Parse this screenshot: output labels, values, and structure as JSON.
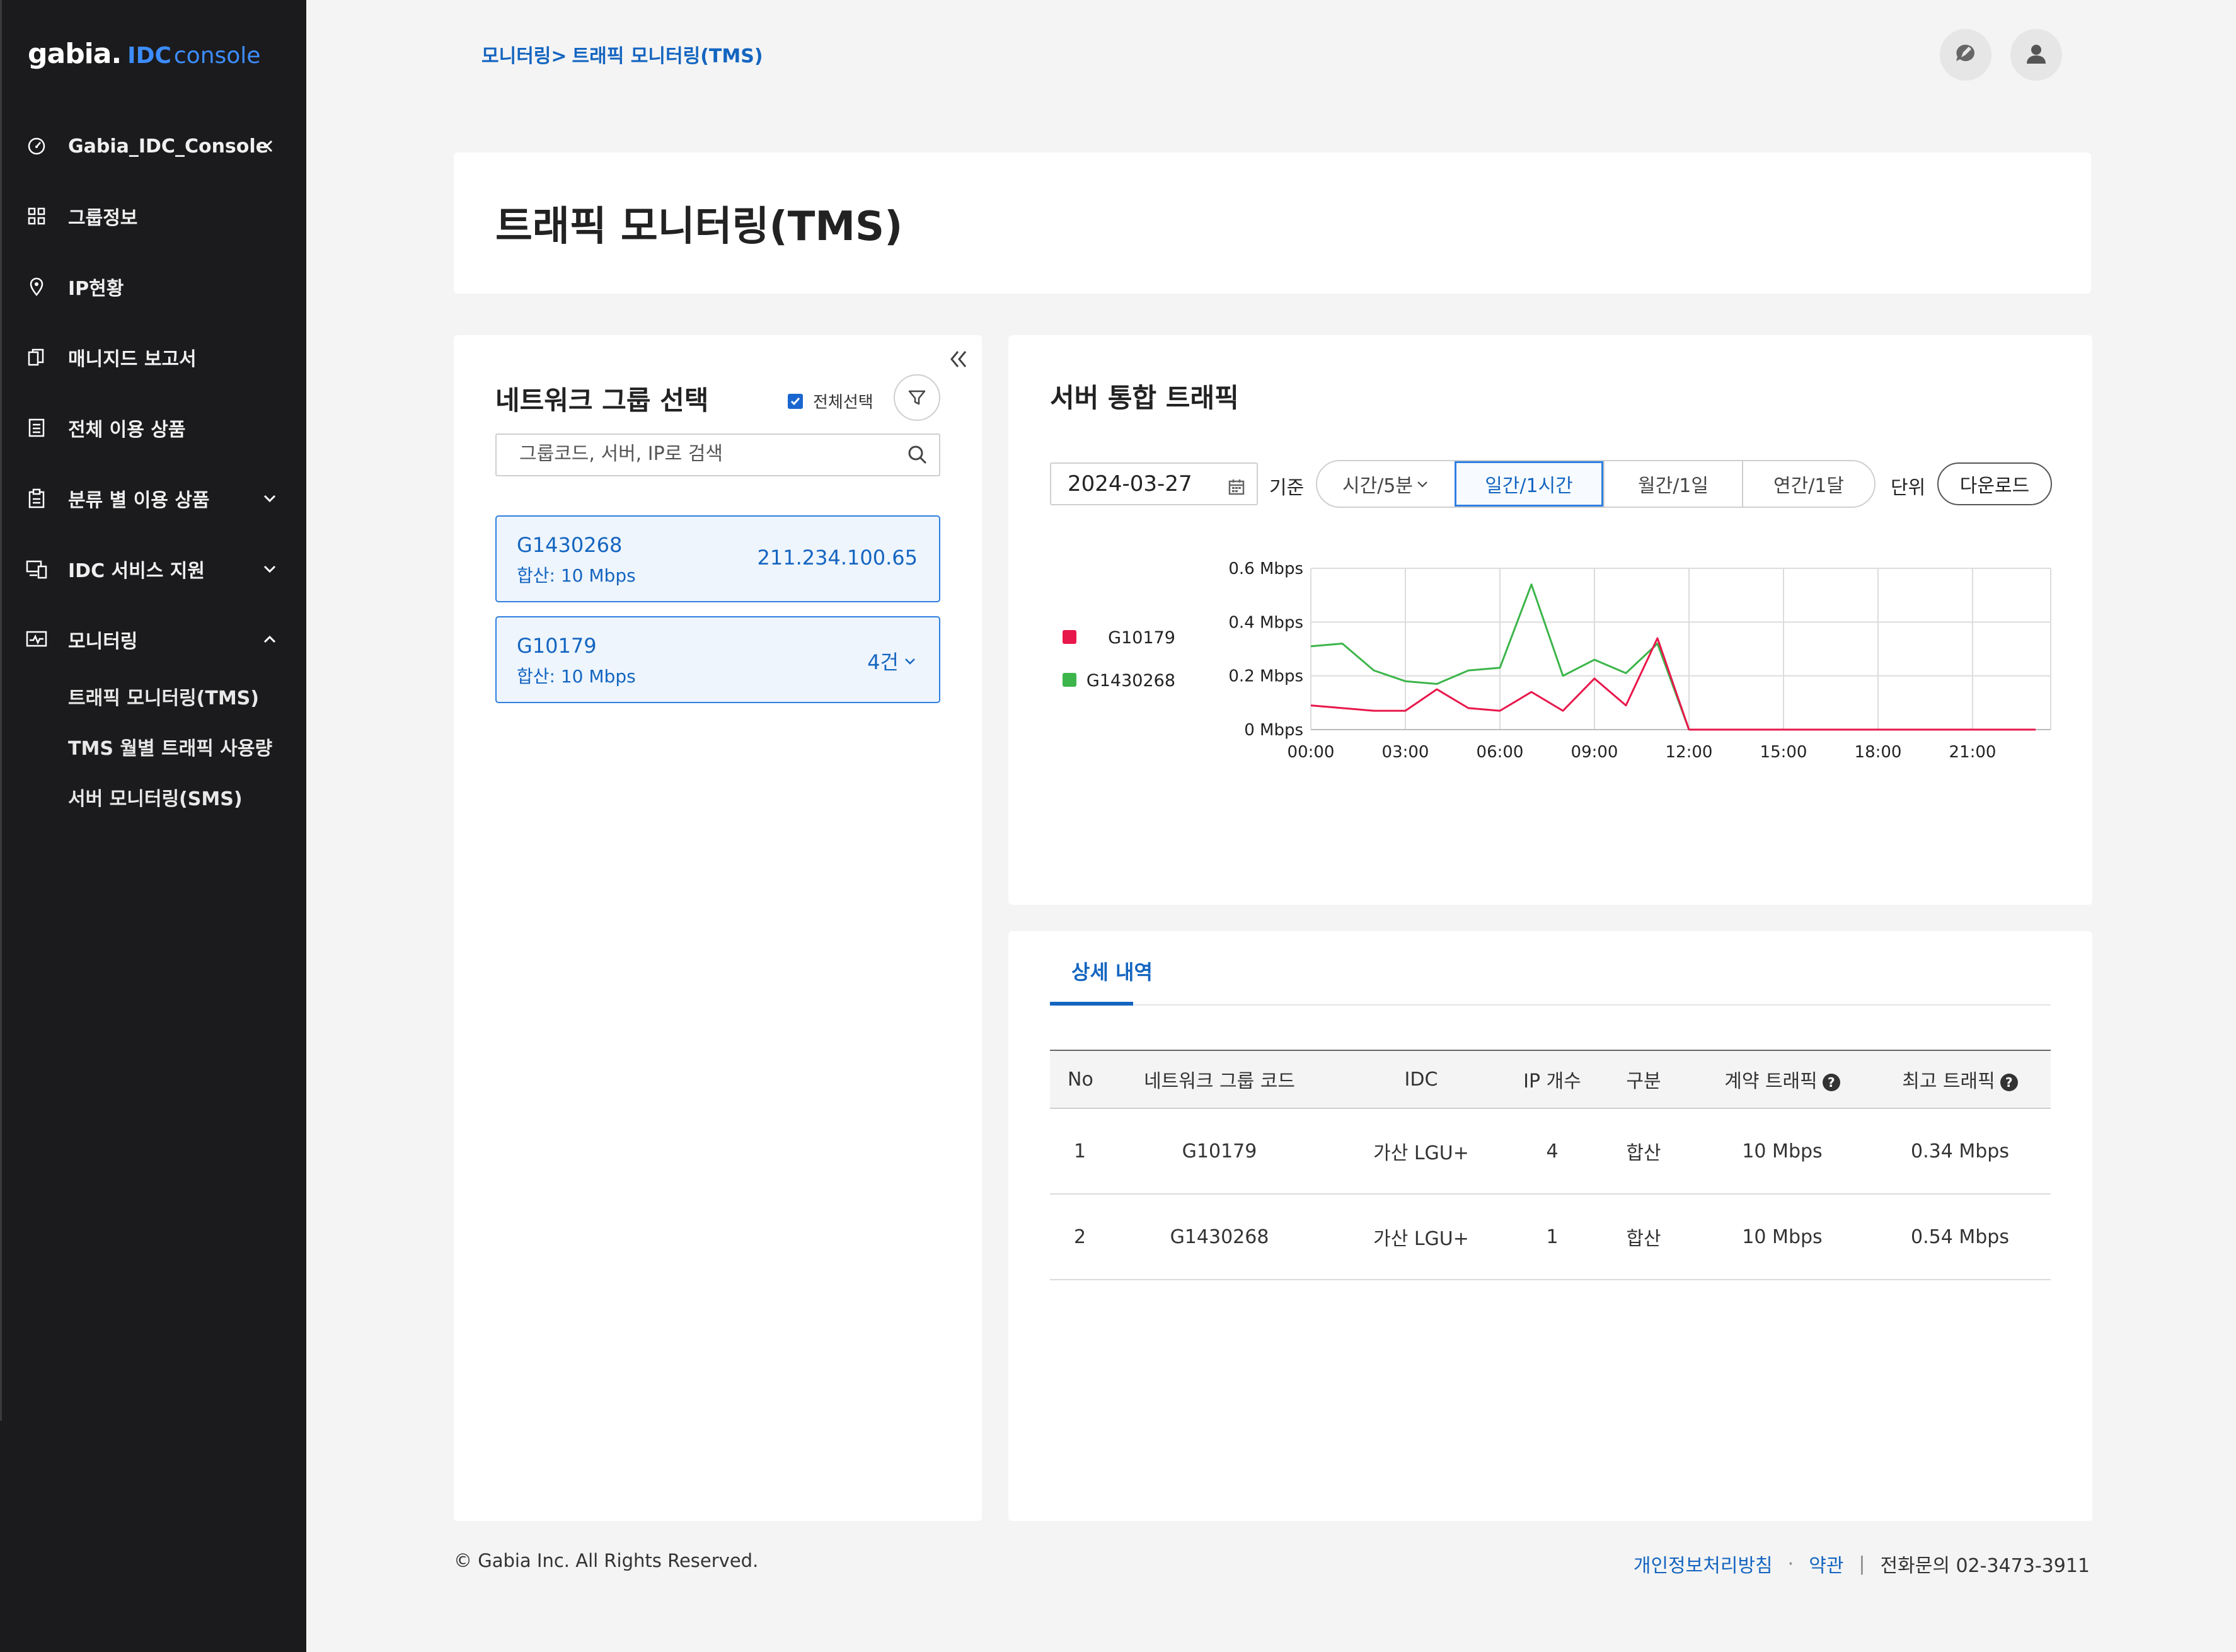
{
  "brand": {
    "logo_main": "gabia.",
    "logo_idc": "IDC",
    "logo_console": "console"
  },
  "sidebar": {
    "items": [
      {
        "label": "Gabia_IDC_Console",
        "icon": "dashboard-icon"
      },
      {
        "label": "그룹정보",
        "icon": "grid-icon"
      },
      {
        "label": "IP현황",
        "icon": "location-pin-icon"
      },
      {
        "label": "매니지드 보고서",
        "icon": "copy-document-icon"
      },
      {
        "label": "전체 이용 상품",
        "icon": "list-document-icon"
      },
      {
        "label": "분류 별 이용 상품",
        "icon": "clipboard-icon"
      },
      {
        "label": "IDC 서비스 지원",
        "icon": "devices-icon"
      },
      {
        "label": "모니터링",
        "icon": "monitor-chart-icon"
      }
    ],
    "sub_items": [
      {
        "label": "트래픽 모니터링(TMS)"
      },
      {
        "label": "TMS 월별 트래픽 사용량"
      },
      {
        "label": "서버 모니터링(SMS)"
      }
    ]
  },
  "breadcrumb": {
    "parent": "모니터링>",
    "current": "트래픽 모니터링(TMS)"
  },
  "page_title": "트래픽 모니터링(TMS)",
  "network_panel": {
    "title": "네트워크 그룹 선택",
    "select_all_label": "전체선택",
    "search_placeholder": "그룹코드, 서버, IP로 검색",
    "groups": [
      {
        "code": "G1430268",
        "summary": "합산: 10 Mbps",
        "right": "211.234.100.65"
      },
      {
        "code": "G10179",
        "summary": "합산: 10 Mbps",
        "right": "4건"
      }
    ]
  },
  "traffic_panel": {
    "title": "서버 통합 트래픽",
    "date": "2024-03-27",
    "basis_label": "기준",
    "periods": [
      "시간/5분",
      "일간/1시간",
      "월간/1일",
      "연간/1달"
    ],
    "active_period": "일간/1시간",
    "unit_label": "단위",
    "download_label": "다운로드"
  },
  "chart_data": {
    "type": "line",
    "x": [
      "00:00",
      "01:00",
      "02:00",
      "03:00",
      "04:00",
      "05:00",
      "06:00",
      "07:00",
      "08:00",
      "09:00",
      "10:00",
      "11:00",
      "12:00",
      "13:00",
      "14:00",
      "15:00",
      "16:00",
      "17:00",
      "18:00",
      "19:00",
      "20:00",
      "21:00",
      "22:00",
      "23:00"
    ],
    "x_ticks": [
      "00:00",
      "03:00",
      "06:00",
      "09:00",
      "12:00",
      "15:00",
      "18:00",
      "21:00"
    ],
    "y_ticks": [
      "0.6 Mbps",
      "0.4 Mbps",
      "0.2 Mbps",
      "0 Mbps"
    ],
    "ylim": [
      0,
      0.6
    ],
    "legend_position": "left",
    "grid": true,
    "series": [
      {
        "name": "G10179",
        "color": "#e8174b",
        "values": [
          0.09,
          0.08,
          0.07,
          0.07,
          0.15,
          0.08,
          0.07,
          0.14,
          0.07,
          0.19,
          0.09,
          0.34,
          0,
          0,
          0,
          0,
          0,
          0,
          0,
          0,
          0,
          0,
          0,
          0
        ]
      },
      {
        "name": "G1430268",
        "color": "#3cb54a",
        "values": [
          0.31,
          0.32,
          0.22,
          0.18,
          0.17,
          0.22,
          0.23,
          0.54,
          0.2,
          0.26,
          0.21,
          0.32,
          0,
          0,
          0,
          0,
          0,
          0,
          0,
          0,
          0,
          0,
          0,
          0
        ]
      }
    ]
  },
  "detail": {
    "tab": "상세 내역",
    "headers": [
      "No",
      "네트워크 그룹 코드",
      "IDC",
      "IP 개수",
      "구분",
      "계약 트래픽",
      "최고 트래픽"
    ],
    "rows": [
      {
        "no": "1",
        "code": "G10179",
        "idc": "가산 LGU+",
        "ips": "4",
        "type": "합산",
        "contract": "10 Mbps",
        "peak": "0.34 Mbps"
      },
      {
        "no": "2",
        "code": "G1430268",
        "idc": "가산 LGU+",
        "ips": "1",
        "type": "합산",
        "contract": "10 Mbps",
        "peak": "0.54 Mbps"
      }
    ]
  },
  "footer": {
    "copyright": "© Gabia Inc. All Rights Reserved.",
    "privacy": "개인정보처리방침",
    "dot": "·",
    "terms": "약관",
    "bar": "|",
    "phone": "전화문의 02-3473-3911"
  }
}
